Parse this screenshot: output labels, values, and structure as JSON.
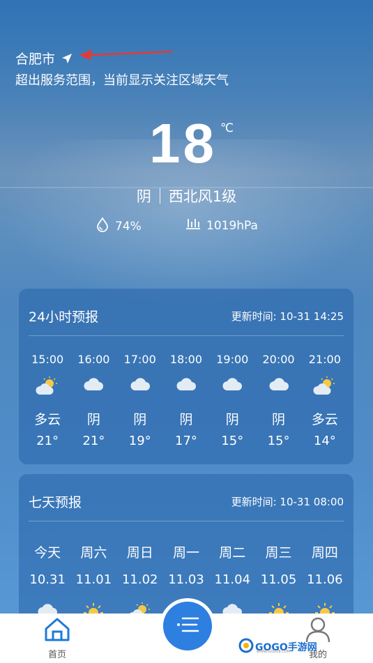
{
  "location": {
    "city": "合肥市",
    "notice": "超出服务范围，当前显示关注区域天气"
  },
  "current": {
    "temp": "18",
    "unit": "℃",
    "condition": "阴",
    "wind": "西北风1级",
    "humidity": "74%",
    "pressure": "1019hPa"
  },
  "hourly": {
    "title": "24小时预报",
    "updated": "更新时间: 10-31 14:25",
    "items": [
      {
        "time": "15:00",
        "icon": "partly-cloudy-icon",
        "cond": "多云",
        "temp": "21°"
      },
      {
        "time": "16:00",
        "icon": "cloud-icon",
        "cond": "阴",
        "temp": "21°"
      },
      {
        "time": "17:00",
        "icon": "cloud-icon",
        "cond": "阴",
        "temp": "19°"
      },
      {
        "time": "18:00",
        "icon": "cloud-icon",
        "cond": "阴",
        "temp": "17°"
      },
      {
        "time": "19:00",
        "icon": "cloud-icon",
        "cond": "阴",
        "temp": "15°"
      },
      {
        "time": "20:00",
        "icon": "cloud-icon",
        "cond": "阴",
        "temp": "15°"
      },
      {
        "time": "21:00",
        "icon": "partly-cloudy-icon",
        "cond": "多云",
        "temp": "14°"
      }
    ]
  },
  "weekly": {
    "title": "七天预报",
    "updated": "更新时间: 10-31 08:00",
    "items": [
      {
        "day": "今天",
        "date": "10.31",
        "icon": "cloud-icon"
      },
      {
        "day": "周六",
        "date": "11.01",
        "icon": "sun-icon"
      },
      {
        "day": "周日",
        "date": "11.02",
        "icon": "partly-cloudy-icon"
      },
      {
        "day": "周一",
        "date": "11.03",
        "icon": "cloud-icon"
      },
      {
        "day": "周二",
        "date": "11.04",
        "icon": "cloud-icon"
      },
      {
        "day": "周三",
        "date": "11.05",
        "icon": "sun-icon"
      },
      {
        "day": "周四",
        "date": "11.06",
        "icon": "sun-icon"
      }
    ]
  },
  "tabbar": {
    "home": "首页",
    "mine": "我的"
  },
  "watermark": {
    "text": "GOGO手游网",
    "sub": "WWW.GOGO8.COM"
  },
  "colors": {
    "accent": "#2d7fe0",
    "annotation_arrow": "#e53935"
  }
}
